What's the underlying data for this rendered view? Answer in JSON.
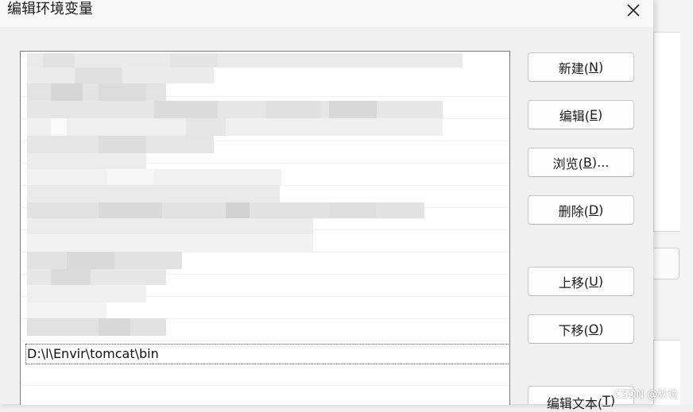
{
  "dialog": {
    "title": "编辑环境变量",
    "close_icon": "close-icon"
  },
  "list": {
    "blurred_rows_count_visible": 12,
    "entry": "D:\\l\\Envir\\tomcat\\bin"
  },
  "buttons": {
    "new": {
      "text": "新建(",
      "key": "N",
      "tail": ")"
    },
    "edit": {
      "text": "编辑(",
      "key": "E",
      "tail": ")"
    },
    "browse": {
      "text": "浏览(",
      "key": "B",
      "tail": ")..."
    },
    "delete": {
      "text": "删除(",
      "key": "D",
      "tail": ")"
    },
    "move_up": {
      "text": "上移(",
      "key": "U",
      "tail": ")"
    },
    "move_down": {
      "text": "下移(",
      "key": "O",
      "tail": ")"
    },
    "edit_text": {
      "text": "编辑文本(",
      "key": "T",
      "tail": ")"
    }
  },
  "watermark": "CSDN @秋说",
  "colors": {
    "dialog_bg": "#f0f0f0",
    "list_bg": "#ffffff",
    "button_border": "#c7c7c7"
  }
}
